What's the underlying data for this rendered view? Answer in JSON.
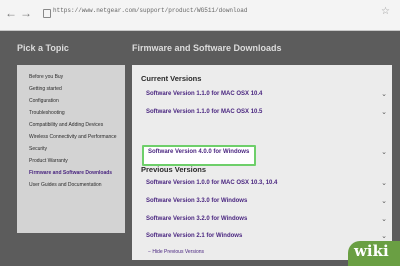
{
  "browser": {
    "url": "https://www.netgear.com/support/product/WG511/download",
    "back_icon": "←",
    "forward_icon": "→",
    "star_icon": "☆"
  },
  "headers": {
    "left": "Pick a Topic",
    "right": "Firmware and Software Downloads"
  },
  "sidebar": {
    "items": [
      {
        "label": "Before you Buy",
        "active": false
      },
      {
        "label": "Getting started",
        "active": false
      },
      {
        "label": "Configuration",
        "active": false
      },
      {
        "label": "Troubleshooting",
        "active": false
      },
      {
        "label": "Compatibility and Adding Devices",
        "active": false
      },
      {
        "label": "Wireless Connectivity and Performance",
        "active": false
      },
      {
        "label": "Security",
        "active": false
      },
      {
        "label": "Product Warranty",
        "active": false
      },
      {
        "label": "Firmware and Software Downloads",
        "active": true
      },
      {
        "label": "User Guides and Documentation",
        "active": false
      }
    ]
  },
  "current_versions": {
    "heading": "Current Versions",
    "items": [
      "Software Version 1.1.0 for MAC OSX 10.4",
      "Software Version 1.1.0 for MAC OSX 10.5",
      "Software Version 4.0.0 for Windows"
    ]
  },
  "previous_versions": {
    "heading": "Previous Versions",
    "items": [
      "Software Version 1.0.0 for MAC OSX 10.3, 10.4",
      "Software Version 3.3.0 for Windows",
      "Software Version 3.2.0 for Windows",
      "Software Version 2.1 for Windows"
    ]
  },
  "hide_previous": "Hide Previous Versions",
  "chevron_icon": "⌄",
  "logo": "wiki",
  "colors": {
    "link": "#4a2680",
    "highlight": "#6ecf6a",
    "logo_bg": "#6a9f43"
  }
}
